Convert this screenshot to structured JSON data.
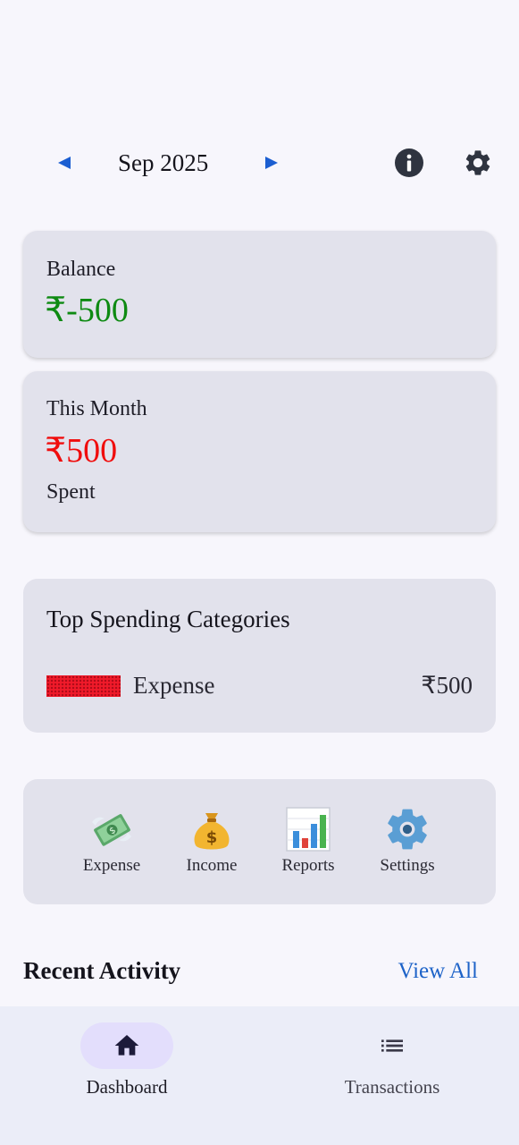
{
  "header": {
    "month": "Sep 2025",
    "prev_icon": "triangle-left-icon",
    "next_icon": "triangle-right-icon",
    "info_icon": "info-icon",
    "settings_icon": "gear-icon",
    "arrow_color": "#1b5ed1"
  },
  "balance_card": {
    "label": "Balance",
    "amount": "₹-500",
    "color": "#0e8a12"
  },
  "month_card": {
    "label": "This Month",
    "amount": "₹500",
    "sub_label": "Spent",
    "color": "#f00d0d"
  },
  "categories": {
    "title": "Top Spending Categories",
    "items": [
      {
        "name": "Expense",
        "amount": "₹500",
        "bar_color": "#f01a2a",
        "share": 1.0
      }
    ]
  },
  "quick_actions": [
    {
      "label": "Expense",
      "icon": "money-with-wings-icon"
    },
    {
      "label": "Income",
      "icon": "money-bag-icon"
    },
    {
      "label": "Reports",
      "icon": "bar-chart-icon"
    },
    {
      "label": "Settings",
      "icon": "gear-emoji-icon"
    }
  ],
  "recent": {
    "title": "Recent Activity",
    "view_all": "View All"
  },
  "bottom_nav": {
    "items": [
      {
        "label": "Dashboard",
        "icon": "home-icon",
        "active": true
      },
      {
        "label": "Transactions",
        "icon": "list-icon",
        "active": false
      }
    ]
  }
}
